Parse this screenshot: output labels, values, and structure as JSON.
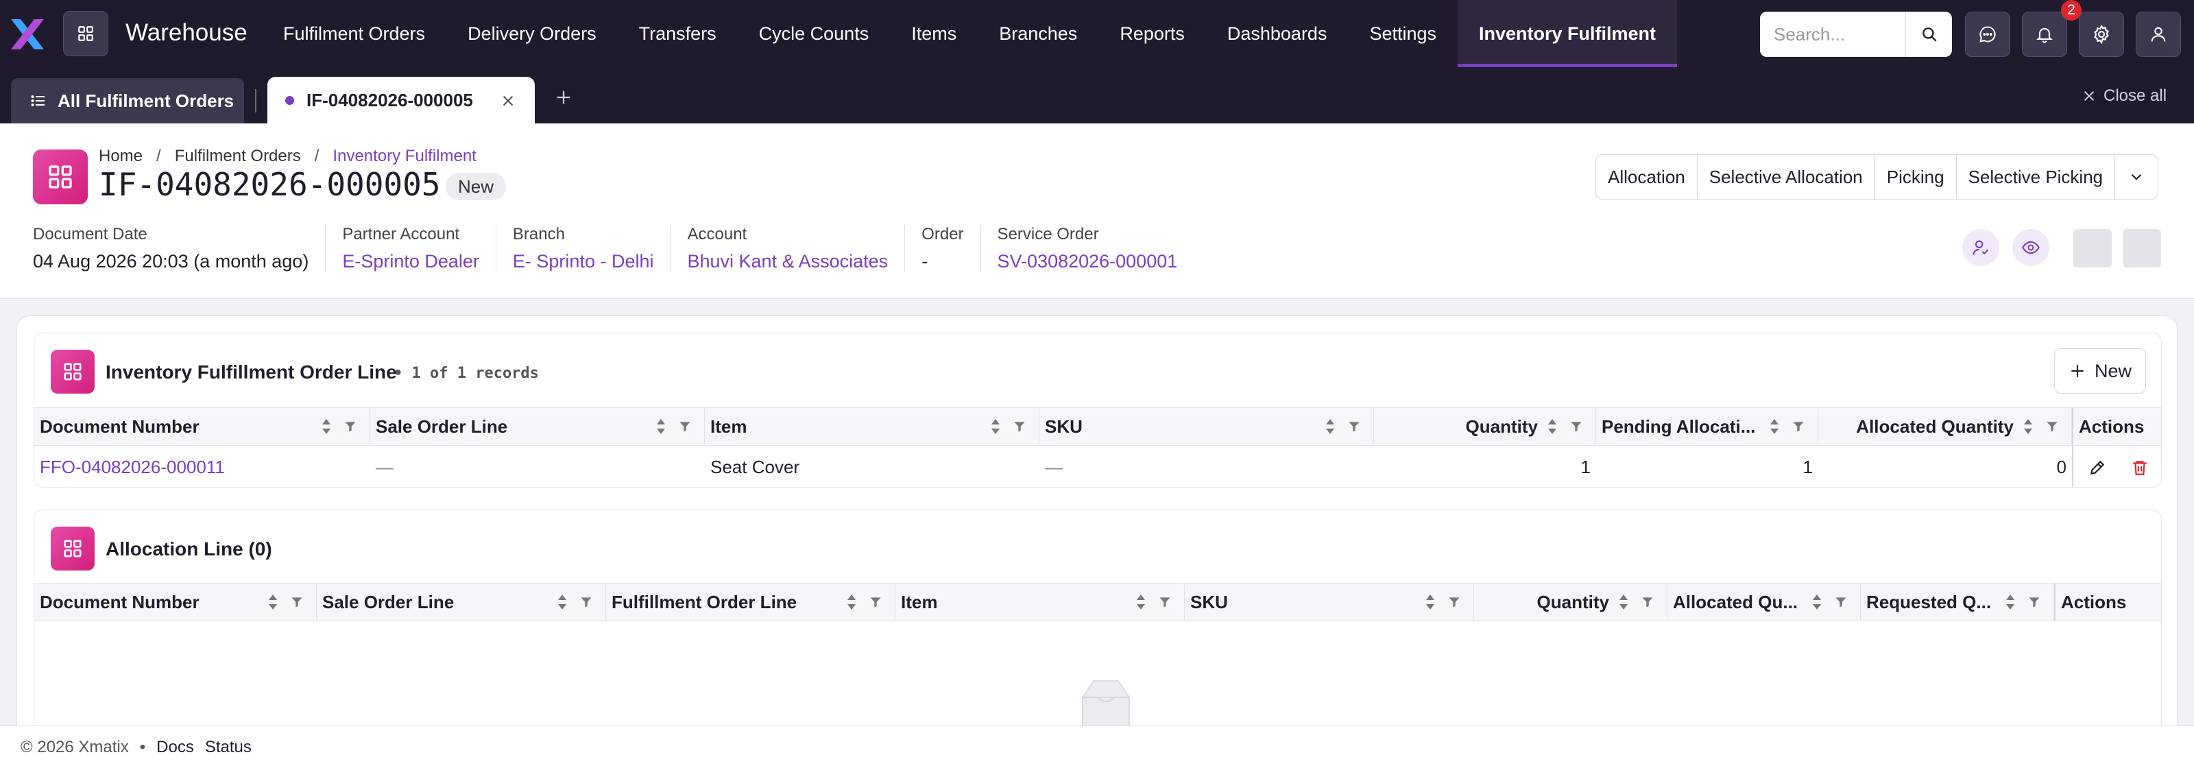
{
  "app": {
    "name": "Warehouse"
  },
  "nav": {
    "items": [
      "Fulfilment Orders",
      "Delivery Orders",
      "Transfers",
      "Cycle Counts",
      "Items",
      "Branches",
      "Reports",
      "Dashboards",
      "Settings",
      "Inventory Fulfilment"
    ],
    "active": "Inventory Fulfilment"
  },
  "search": {
    "placeholder": "Search..."
  },
  "notifications": {
    "count": "2"
  },
  "tabs": {
    "all_label": "All Fulfilment Orders",
    "current_label": "IF-04082026-000005",
    "close_all": "Close all"
  },
  "breadcrumb": {
    "home": "Home",
    "section": "Fulfilment Orders",
    "current": "Inventory Fulfilment"
  },
  "document": {
    "number": "IF-04082026-000005",
    "status": "New",
    "fields": {
      "document_date": {
        "label": "Document Date",
        "value": "04 Aug 2026 20:03 (a month ago)"
      },
      "partner_account": {
        "label": "Partner Account",
        "value": "E-Sprinto Dealer"
      },
      "branch": {
        "label": "Branch",
        "value": "E- Sprinto - Delhi"
      },
      "account": {
        "label": "Account",
        "value": "Bhuvi Kant & Associates"
      },
      "order": {
        "label": "Order",
        "value": "-"
      },
      "service_order": {
        "label": "Service Order",
        "value": "SV-03082026-000001"
      }
    }
  },
  "actions": {
    "allocation": "Allocation",
    "selective_allocation": "Selective Allocation",
    "picking": "Picking",
    "selective_picking": "Selective Picking"
  },
  "fulfillment_lines": {
    "title": "Inventory Fulfillment Order Line",
    "count_text": "• 1 of 1 records",
    "new_label": "New",
    "columns": {
      "document_number": "Document Number",
      "sale_order_line": "Sale Order Line",
      "item": "Item",
      "sku": "SKU",
      "quantity": "Quantity",
      "pending_allocation": "Pending Allocati...",
      "allocated_quantity": "Allocated Quantity",
      "actions": "Actions"
    },
    "rows": [
      {
        "document_number": "FFO-04082026-000011",
        "sale_order_line": "—",
        "item": "Seat Cover",
        "sku": "—",
        "quantity": "1",
        "pending_allocation": "1",
        "allocated_quantity": "0"
      }
    ]
  },
  "allocation_lines": {
    "title": "Allocation Line (0)",
    "columns": {
      "document_number": "Document Number",
      "sale_order_line": "Sale Order Line",
      "fulfillment_order_line": "Fulfillment Order Line",
      "item": "Item",
      "sku": "SKU",
      "quantity": "Quantity",
      "allocated_quantity": "Allocated Qu...",
      "requested_quantity": "Requested Q...",
      "actions": "Actions"
    }
  },
  "footer": {
    "copyright": "© 2026 Xmatix",
    "separator": "•",
    "docs": "Docs",
    "status": "Status"
  },
  "colors": {
    "brand": "#7a3fbf",
    "topbar": "#1f1a2c",
    "icon_pink": "#d31f7b",
    "delete_red": "#e0252e"
  }
}
